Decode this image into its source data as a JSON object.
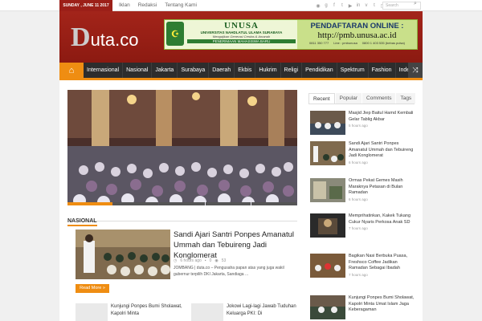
{
  "topbar": {
    "date": "SUNDAY , JUNE 11 2017",
    "links": [
      "Iklan",
      "Redaksi",
      "Tentang Kami"
    ],
    "social_icons": [
      "rss-icon",
      "google-plus-icon",
      "facebook-icon",
      "twitter-icon",
      "youtube-icon",
      "linkedin-icon",
      "vimeo-icon",
      "tumblr-icon",
      "instagram-icon"
    ],
    "search_placeholder": "Search"
  },
  "header": {
    "logo_d": "D",
    "logo_rest": "uta.co"
  },
  "banner": {
    "unusa": "UNUSA",
    "university": "UNIVERSITAS NAHDLATUL ULAMA SURABAYA",
    "tagline": "Mengajikan Generasi Cerdas & Amanah",
    "pmb": "PENERIMAAN MAHASISWA BARU",
    "daftar": "PENDAFTARAN ONLINE :",
    "url": "http://pmb.unusa.ac.id",
    "phone1": "0811 350 777",
    "line": "Line : pmbunusa",
    "phone2": "0800 1 403 535 (bebas pulsa)"
  },
  "nav": {
    "items": [
      "Internasional",
      "Nasional",
      "Jakarta",
      "Surabaya",
      "Daerah",
      "Ekbis",
      "Hukrim",
      "Religi",
      "Pendidikan",
      "Spektrum",
      "Fashion",
      "Index"
    ]
  },
  "section": {
    "title": "NASIONAL"
  },
  "featured": {
    "title": "Sandi Ajari Santri Ponpes Amanatul Ummah dan Tebuireng Jadi Konglomerat",
    "time": "6 hours ago",
    "comments": "0",
    "views": "53",
    "excerpt": "JOMBANG | duta.co – Pengusaha papan atas yang juga wakil gubernur terpilih DKI Jakarta, Sandiaga ...",
    "readmore": "Read More »"
  },
  "small_posts": [
    "Kunjungi Ponpes Bumi Sholawat, Kapolri Minta",
    "Jokowi Lagi-lagi Jawab Tuduhan Keluarga PKI: Di"
  ],
  "sidebar": {
    "tabs": [
      "Recent",
      "Popular",
      "Comments",
      "Tags"
    ],
    "items": [
      {
        "title": "Masjid Jiep Baitul Hamd Kembali Gelar Tablig Akbar",
        "ago": "5 hours ago"
      },
      {
        "title": "Sandi Ajari Santri Ponpes Amanatul Ummah dan Tebuireng Jadi Konglomerat",
        "ago": "6 hours ago"
      },
      {
        "title": "Ormas Pekat Gemes Masih Maraknya Petasan di Bulan Ramadan",
        "ago": "6 hours ago"
      },
      {
        "title": "Memprihatinkan, Kakek Tukang Cukur Nyaris Perkosa Anak SD",
        "ago": "7 hours ago"
      },
      {
        "title": "Bagikan Nasi Berbuka Puasa, Freshsco Coffee Jadikan Ramadan Sebagai Ibadah",
        "ago": "7 hours ago"
      },
      {
        "title": "Kunjungi Ponpes Bumi Sholawat, Kapolri Minta Umat Islam Jaga Keberagaman",
        "ago": ""
      }
    ]
  },
  "colors": {
    "brand_red": "#9b1d13",
    "accent_orange": "#ef8d12",
    "nav_dark": "#2d2d2d"
  }
}
